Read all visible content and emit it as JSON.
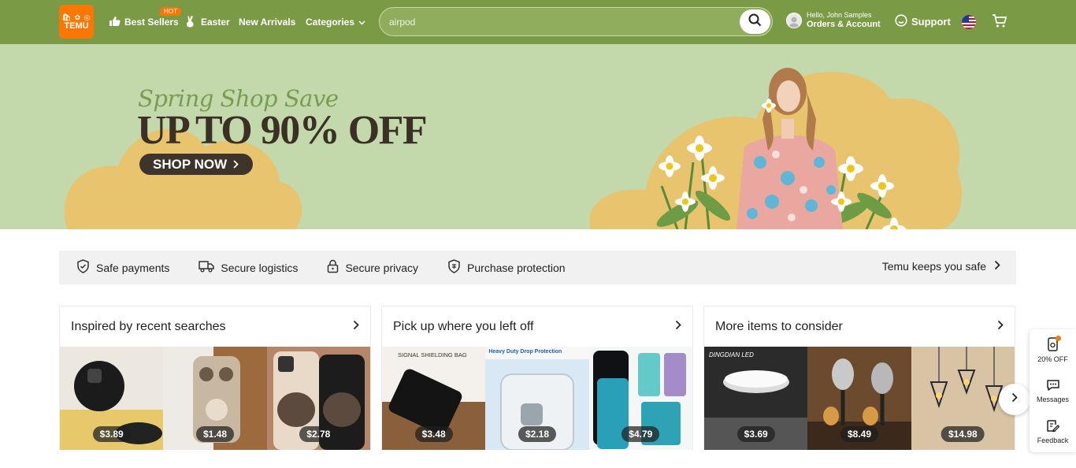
{
  "header": {
    "logo_top": "🛍 ✿ ◎",
    "logo_text": "TEMU",
    "nav": [
      {
        "label": "Best Sellers",
        "icon": "thumbs-up-icon"
      },
      {
        "label": "Easter",
        "icon": "bunny-icon"
      },
      {
        "label": "New Arrivals"
      },
      {
        "label": "Categories",
        "icon": "chevron-down-icon"
      }
    ],
    "hot_badge": "HOT",
    "search": {
      "value": "airpod",
      "placeholder": "airpod"
    },
    "account": {
      "hello": "Hello, John Samples",
      "orders": "Orders & Account"
    },
    "support": "Support",
    "brand_color": "#7b9a45",
    "accent_color": "#fb7701"
  },
  "banner": {
    "script_text": "Spring Shop Save",
    "headline": "UP TO 90% OFF",
    "cta": "SHOP NOW",
    "background": "#c3d8ab"
  },
  "trust": {
    "items": [
      {
        "label": "Safe payments",
        "icon": "shield-check-icon"
      },
      {
        "label": "Secure logistics",
        "icon": "truck-icon"
      },
      {
        "label": "Secure privacy",
        "icon": "lock-icon"
      },
      {
        "label": "Purchase protection",
        "icon": "badge-shield-icon"
      }
    ],
    "right_link": "Temu keeps you safe"
  },
  "cards": [
    {
      "title": "Inspired by recent searches",
      "items": [
        {
          "price": "$3.89"
        },
        {
          "price": "$1.48"
        },
        {
          "price": "$2.78"
        }
      ]
    },
    {
      "title": "Pick up where you left off",
      "items": [
        {
          "price": "$3.48",
          "caption": "SIGNAL SHIELDING BAG"
        },
        {
          "price": "$2.18",
          "caption": "Heavy Duty Drop Protection"
        },
        {
          "price": "$4.79"
        }
      ]
    },
    {
      "title": "More items to consider",
      "items": [
        {
          "price": "$3.69",
          "caption": "DINGDIAN LED"
        },
        {
          "price": "$8.49"
        },
        {
          "price": "$14.98"
        }
      ]
    }
  ],
  "side_widget": {
    "items": [
      {
        "label": "20% OFF",
        "icon": "coupon-phone-icon"
      },
      {
        "label": "Messages",
        "icon": "chat-icon"
      },
      {
        "label": "Feedback",
        "icon": "feedback-icon"
      }
    ]
  }
}
